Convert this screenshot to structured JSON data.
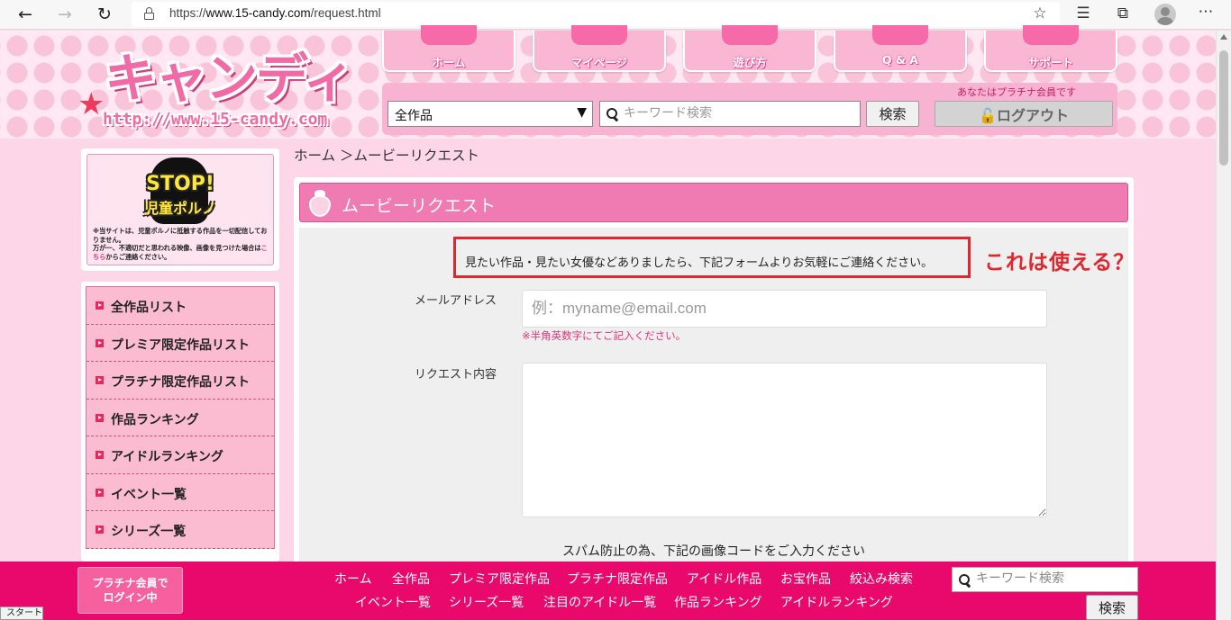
{
  "browser": {
    "url_prefix": "https://",
    "url_host": "www.15-candy.com",
    "url_path": "/request.html",
    "icons": [
      "back-icon",
      "forward-icon",
      "reload-icon",
      "lock-icon",
      "favorite-add-icon",
      "favorites-icon",
      "collections-icon",
      "profile-icon",
      "more-icon"
    ]
  },
  "header": {
    "logo_text": "キャンディ",
    "logo_url": "http://www.15-candy.com",
    "nav": [
      "ホーム",
      "マイページ",
      "遊び方",
      "Q & A",
      "サポート"
    ],
    "member_status": "あなたはプラチナ会員です",
    "category_selected": "全作品",
    "search_placeholder": "キーワード検索",
    "search_button": "検索",
    "logout_button": "ログアウト"
  },
  "sidebar": {
    "banner_title": "STOP!",
    "banner_subtitle": "児童ポルノ",
    "banner_text_1": "※当サイトは、児童ポルノに抵触する作品を一切配信しておりません。",
    "banner_text_2": "万が一、不適切だと思われる映像、画像を見つけた場合は",
    "banner_link": "こちら",
    "banner_text_3": "からご連絡ください。",
    "menu": [
      "全作品リスト",
      "プレミア限定作品リスト",
      "プラチナ限定作品リスト",
      "作品ランキング",
      "アイドルランキング",
      "イベント一覧",
      "シリーズ一覧"
    ]
  },
  "main": {
    "breadcrumb": "ホーム ＞ムービーリクエスト",
    "title": "ムービーリクエスト",
    "intro": "見たい作品・見たい女優などありましたら、下記フォームよりお気軽にご連絡ください。",
    "email_label": "メールアドレス",
    "email_placeholder": "例：myname@email.com",
    "email_note": "※半角英数字にてご記入ください。",
    "request_label": "リクエスト内容",
    "spam_note": "スパム防止の為、下記の画像コードをご入力ください"
  },
  "annotation": "これは使える？",
  "footer": {
    "login_state_1": "プラチナ会員で",
    "login_state_2": "ログイン中",
    "links_row1": [
      "ホーム",
      "全作品",
      "プレミア限定作品",
      "プラチナ限定作品",
      "アイドル作品",
      "お宝作品",
      "絞込み検索"
    ],
    "links_row2": [
      "イベント一覧",
      "シリーズ一覧",
      "注目のアイドル一覧",
      "作品ランキング",
      "アイドルランキング"
    ],
    "search_placeholder": "キーワード検索",
    "search_button": "検索"
  },
  "taskbar": {
    "start": "スタート"
  },
  "colors": {
    "brand_pink": "#f07ab2",
    "footer_pink": "#e9096c",
    "annotation_red": "#e0262f"
  }
}
